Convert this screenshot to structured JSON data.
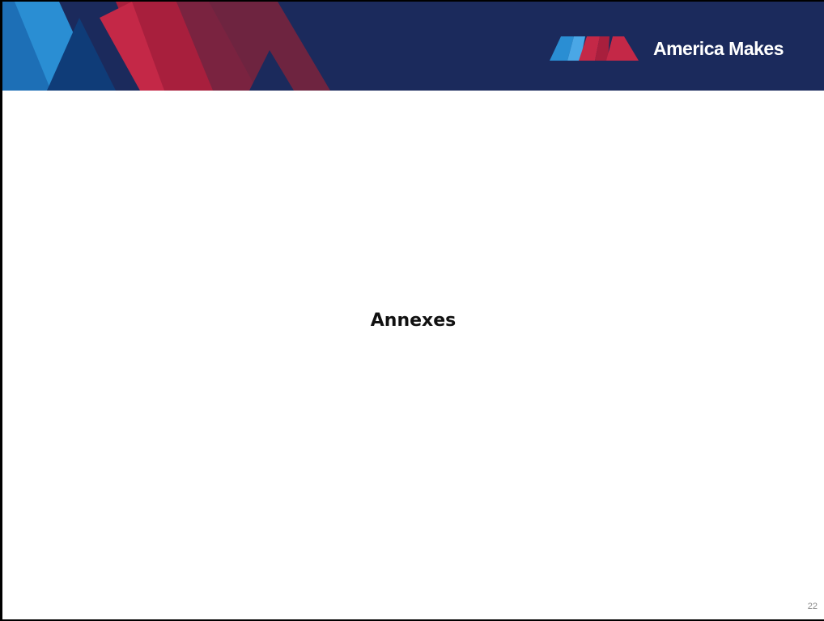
{
  "header": {
    "logo": {
      "text": "America Makes",
      "icon": "america-makes-logo-mark"
    },
    "colors": {
      "navy": "#1b2a5c",
      "blue": "#2a8ed3",
      "dark_blue": "#0f3c78",
      "red": "#b21e3c",
      "maroon": "#7a2340"
    }
  },
  "slide": {
    "title": "Annexes",
    "page_number": "22"
  }
}
